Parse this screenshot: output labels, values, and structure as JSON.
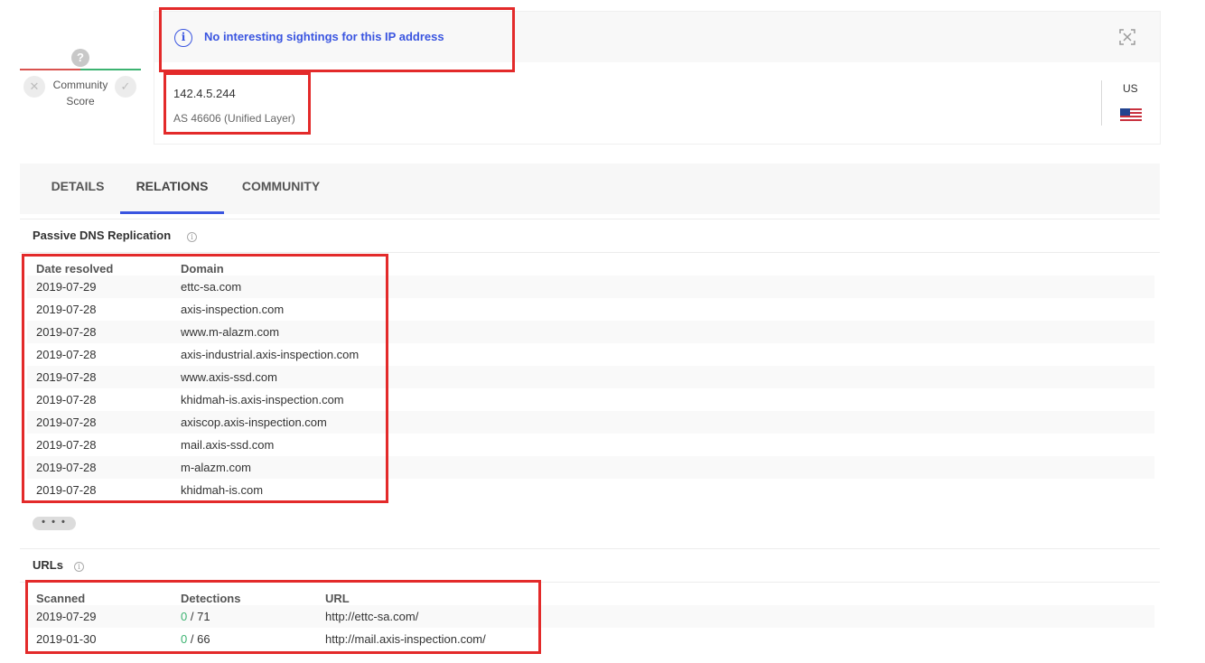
{
  "community_score": {
    "label_line1": "Community",
    "label_line2": "Score",
    "unknown_glyph": "?"
  },
  "header": {
    "banner_message": "No interesting sightings for this IP address",
    "info_icon_glyph": "i",
    "ip_address": "142.4.5.244",
    "asn": "AS 46606 (Unified Layer)",
    "country_code": "US",
    "flag_icon": "us-flag-icon"
  },
  "tabs": [
    {
      "label": "DETAILS"
    },
    {
      "label": "RELATIONS",
      "active": true
    },
    {
      "label": "COMMUNITY"
    }
  ],
  "passive_dns": {
    "title": "Passive DNS Replication",
    "columns": [
      "Date resolved",
      "Domain"
    ],
    "rows": [
      {
        "date": "2019-07-29",
        "domain": "ettc-sa.com"
      },
      {
        "date": "2019-07-28",
        "domain": "axis-inspection.com"
      },
      {
        "date": "2019-07-28",
        "domain": "www.m-alazm.com"
      },
      {
        "date": "2019-07-28",
        "domain": "axis-industrial.axis-inspection.com"
      },
      {
        "date": "2019-07-28",
        "domain": "www.axis-ssd.com"
      },
      {
        "date": "2019-07-28",
        "domain": "khidmah-is.axis-inspection.com"
      },
      {
        "date": "2019-07-28",
        "domain": "axiscop.axis-inspection.com"
      },
      {
        "date": "2019-07-28",
        "domain": "mail.axis-ssd.com"
      },
      {
        "date": "2019-07-28",
        "domain": "m-alazm.com"
      },
      {
        "date": "2019-07-28",
        "domain": "khidmah-is.com"
      }
    ],
    "more_label": "• • •"
  },
  "urls": {
    "title": "URLs",
    "columns": [
      "Scanned",
      "Detections",
      "URL"
    ],
    "rows": [
      {
        "scanned": "2019-07-29",
        "detections": "0",
        "total": "/ 71",
        "url": "http://ettc-sa.com/"
      },
      {
        "scanned": "2019-01-30",
        "detections": "0",
        "total": "/ 66",
        "url": "http://mail.axis-inspection.com/"
      }
    ]
  },
  "colors": {
    "accent": "#3a55e0",
    "annotation_red": "#e32a2a",
    "clean_green": "#3cb371"
  }
}
